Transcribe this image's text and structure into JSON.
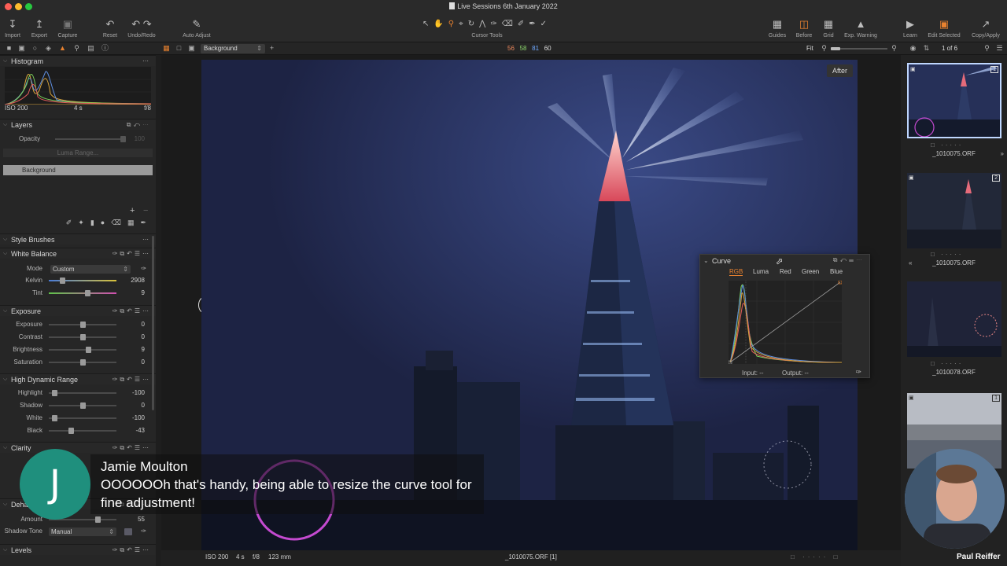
{
  "window": {
    "title": "Live Sessions 6th January 2022"
  },
  "toolbar": {
    "left": [
      {
        "label": "Import",
        "icon": "import-icon"
      },
      {
        "label": "Export",
        "icon": "export-icon"
      },
      {
        "label": "Capture",
        "icon": "camera-icon"
      },
      {
        "label": "Reset",
        "icon": "reset-icon"
      },
      {
        "label": "Undo/Redo",
        "icon": "undo-icon"
      },
      {
        "label": "Auto Adjust",
        "icon": "wand-icon"
      }
    ],
    "center_label": "Cursor Tools",
    "right": [
      {
        "label": "Guides",
        "icon": "guides-icon"
      },
      {
        "label": "Before",
        "icon": "before-icon"
      },
      {
        "label": "Grid",
        "icon": "grid-icon"
      },
      {
        "label": "Exp. Warning",
        "icon": "warning-icon"
      },
      {
        "label": "Learn",
        "icon": "learn-icon"
      },
      {
        "label": "Edit Selected",
        "icon": "edit-selected-icon"
      },
      {
        "label": "Copy/Apply",
        "icon": "copy-apply-icon"
      }
    ]
  },
  "subbar": {
    "layer_select": "Background",
    "readout": {
      "r": "56",
      "g": "58",
      "b": "81",
      "l": "60"
    },
    "fit": "Fit",
    "counter": "1 of 6"
  },
  "histogram": {
    "title": "Histogram",
    "iso": "ISO 200",
    "shutter": "4 s",
    "aperture": "f/8"
  },
  "layers": {
    "title": "Layers",
    "opacity_label": "Opacity",
    "opacity_value": "100",
    "luma_range": "Luma Range...",
    "layer_name": "Background"
  },
  "style_brushes": {
    "title": "Style Brushes"
  },
  "white_balance": {
    "title": "White Balance",
    "mode_label": "Mode",
    "mode_value": "Custom",
    "kelvin_label": "Kelvin",
    "kelvin_value": "2908",
    "kelvin_pos": 0.2,
    "tint_label": "Tint",
    "tint_value": "9",
    "tint_pos": 0.57
  },
  "exposure": {
    "title": "Exposure",
    "rows": [
      {
        "label": "Exposure",
        "value": "0",
        "pos": 0.5
      },
      {
        "label": "Contrast",
        "value": "0",
        "pos": 0.5
      },
      {
        "label": "Brightness",
        "value": "9",
        "pos": 0.58
      },
      {
        "label": "Saturation",
        "value": "0",
        "pos": 0.5
      }
    ]
  },
  "hdr": {
    "title": "High Dynamic Range",
    "rows": [
      {
        "label": "Highlight",
        "value": "-100",
        "pos": 0.08
      },
      {
        "label": "Shadow",
        "value": "0",
        "pos": 0.5
      },
      {
        "label": "White",
        "value": "-100",
        "pos": 0.08
      },
      {
        "label": "Black",
        "value": "-43",
        "pos": 0.32
      }
    ]
  },
  "clarity": {
    "title": "Clarity"
  },
  "dehaze": {
    "title": "Deha",
    "amount_label": "Amount",
    "amount_value": "55",
    "amount_pos": 0.72,
    "shadow_tone_label": "Shadow Tone",
    "shadow_tone_value": "Manual"
  },
  "levels": {
    "title": "Levels"
  },
  "viewer": {
    "after_label": "After"
  },
  "statusbar": {
    "iso": "ISO 200",
    "shutter": "4 s",
    "aperture": "f/8",
    "focal": "123 mm",
    "filename": "_1010075.ORF [1]"
  },
  "curve": {
    "title": "Curve",
    "tabs": [
      "RGB",
      "Luma",
      "Red",
      "Green",
      "Blue"
    ],
    "active_tab": "RGB",
    "input_label": "Input:",
    "input_value": "--",
    "output_label": "Output:",
    "output_value": "--"
  },
  "filmstrip": [
    {
      "name": "_1010075.ORF",
      "badge": "1"
    },
    {
      "name": "_1010075.ORF",
      "badge": "2"
    },
    {
      "name": "_1010078.ORF",
      "badge": ""
    },
    {
      "name": "",
      "badge": "1"
    }
  ],
  "chat": {
    "initial": "J",
    "name": "Jamie Moulton",
    "message": "OOOOOOh that's handy, being able to resize the curve tool for fine adjustment!"
  },
  "watermark": "Paul Reiffer",
  "colors": {
    "accent": "#e9822f",
    "avatar": "#1f8f7d",
    "sky": "#1e2443"
  }
}
